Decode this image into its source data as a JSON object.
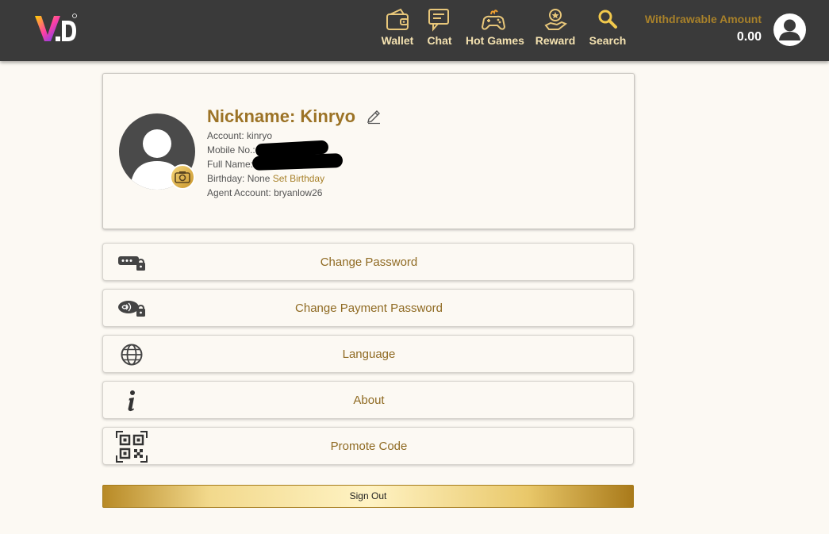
{
  "header": {
    "logo_text": "V.D",
    "nav": [
      {
        "label": "Wallet",
        "icon": "wallet-icon"
      },
      {
        "label": "Chat",
        "icon": "chat-icon"
      },
      {
        "label": "Hot Games",
        "icon": "gamepad-icon"
      },
      {
        "label": "Reward",
        "icon": "reward-icon"
      },
      {
        "label": "Search",
        "icon": "search-icon"
      }
    ],
    "withdrawable_label": "Withdrawable Amount",
    "withdrawable_amount": "0.00",
    "avatar_icon": "user-avatar-icon"
  },
  "profile": {
    "nickname": "Nickname: Kinryo",
    "account_label": "Account:",
    "account_value": "kinryo",
    "mobile_label": "Mobile No.:",
    "fullname_label": "Full Name:",
    "birthday_label": "Birthday:",
    "birthday_value": "None",
    "set_birthday": "Set Birthday",
    "agent_label": "Agent Account:",
    "agent_value": "bryanlow26"
  },
  "menu": [
    {
      "label": "Change Password",
      "icon": "password-lock-icon"
    },
    {
      "label": "Change Payment Password",
      "icon": "payment-lock-icon"
    },
    {
      "label": "Language",
      "icon": "globe-icon"
    },
    {
      "label": "About",
      "icon": "info-icon"
    },
    {
      "label": "Promote Code",
      "icon": "qr-code-icon"
    }
  ],
  "sign_out": "Sign Out",
  "colors": {
    "header_bg": "#3a3a3a",
    "gold": "#a8812a",
    "page_bg": "#fcf9f3"
  }
}
